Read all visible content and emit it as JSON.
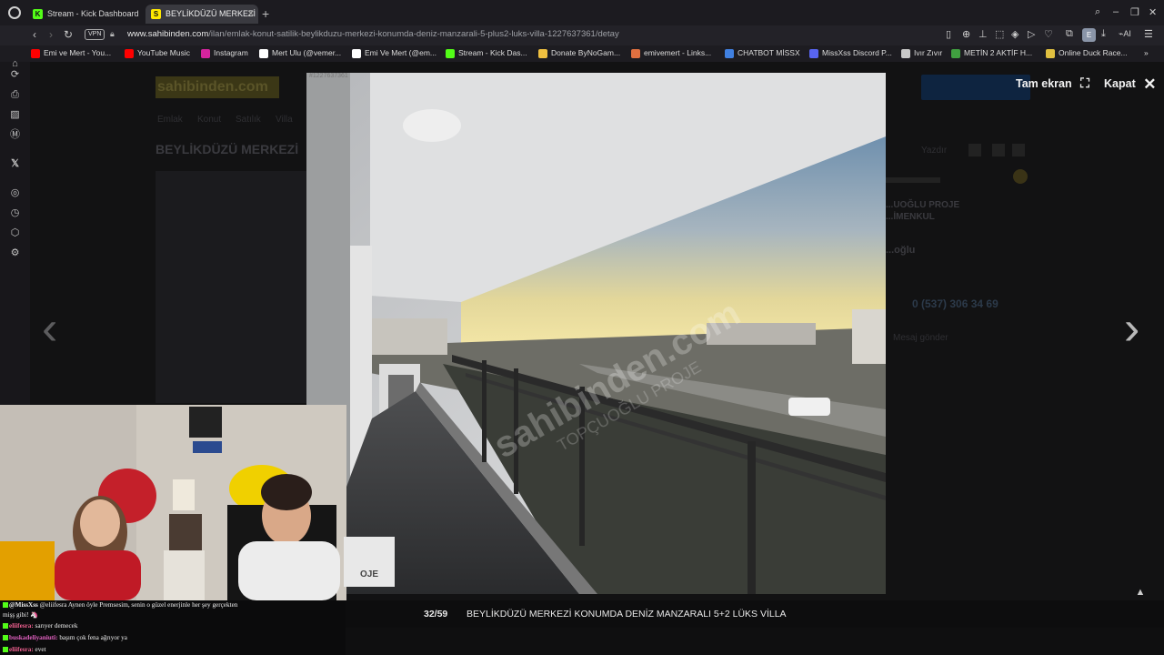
{
  "browser": {
    "tabs": [
      {
        "label": "Stream - Kick Dashboard",
        "favicon": "K"
      },
      {
        "label": "BEYLİKDÜZÜ MERKEZİ KO",
        "favicon": "S"
      }
    ],
    "url_host": "www.sahibinden.com",
    "url_path": "/ilan/emlak-konut-satilik-beylikduzu-merkezi-konumda-deniz-manzarali-5-plus2-luks-villa-1227637361/detay",
    "vpn_label": "VPN",
    "profile_letter": "E",
    "ai_label": "AI"
  },
  "bookmarks": [
    {
      "label": "Emi ve Mert - You...",
      "color": "#ff0000"
    },
    {
      "label": "YouTube Music",
      "color": "#ff0000"
    },
    {
      "label": "Instagram",
      "color": "#d6249f"
    },
    {
      "label": "Mert Ulu (@vemer...",
      "color": "#ffffff"
    },
    {
      "label": "Emi Ve Mert (@em...",
      "color": "#ffffff"
    },
    {
      "label": "Stream - Kick Das...",
      "color": "#53fc18"
    },
    {
      "label": "Donate ByNoGam...",
      "color": "#f0c040"
    },
    {
      "label": "emivemert - Links...",
      "color": "#e07040"
    },
    {
      "label": "CHATBOT MİSSX",
      "color": "#4080e0"
    },
    {
      "label": "MissXss Discord P...",
      "color": "#5865f2"
    },
    {
      "label": "Ivır Zıvır",
      "color": "#c8c8c8"
    },
    {
      "label": "METİN 2 AKTİF H...",
      "color": "#40a040"
    },
    {
      "label": "Online Duck Race...",
      "color": "#e0c040"
    }
  ],
  "page_bg": {
    "logo": "sahibinden.com",
    "breadcrumbs": [
      "Emlak",
      "Konut",
      "Satılık",
      "Villa"
    ],
    "title": "BEYLİKDÜZÜ MERKEZİ",
    "agency": "...UOĞLU PROJE",
    "agency_sub": "...İMENKUL",
    "person": "...oğlu",
    "phone": "0 (537) 306 34 69",
    "message": "Mesaj gönder",
    "links": [
      "Yazdır"
    ]
  },
  "gallery": {
    "counter": "32/59",
    "caption": "BEYLİKDÜZÜ MERKEZİ KONUMDA DENİZ MANZARALI 5+2 LÜKS VİLLA",
    "fullscreen_label": "Tam ekran",
    "close_label": "Kapat",
    "photo_id": "#1227637361",
    "watermark_logo": "OJE"
  },
  "chat": [
    {
      "user": "@MissXss",
      "text": "@eliifesra Aynen öyle Premsesim, senin o güzel enerjinle her şey gerçekten",
      "color": "#f0f0f0"
    },
    {
      "user": "",
      "text": "mişş gibi! 🦄",
      "color": "#f0f0f0"
    },
    {
      "user": "eliifesra:",
      "text": "sarıyer demecek",
      "color": "#f06090"
    },
    {
      "user": "buskadeliyaniuti:",
      "text": "başım çok fena ağrıyor ya",
      "color": "#e060c0"
    },
    {
      "user": "eliifesra:",
      "text": "evet",
      "color": "#f06090"
    }
  ]
}
